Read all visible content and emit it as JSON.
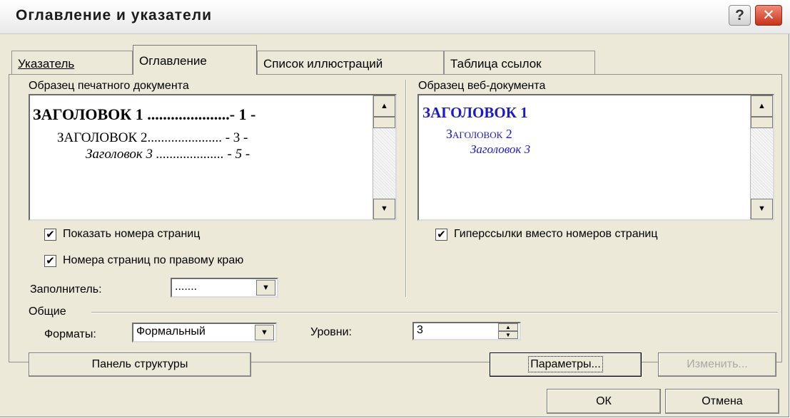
{
  "window": {
    "title": "Оглавление и указатели",
    "help_glyph": "?",
    "close_glyph": "✕"
  },
  "tabs": [
    {
      "label": "Указатель",
      "active": false
    },
    {
      "label": "Оглавление",
      "active": true
    },
    {
      "label": "Список иллюстраций",
      "active": false
    },
    {
      "label": "Таблица ссылок",
      "active": false
    }
  ],
  "print_preview": {
    "label": "Образец печатного документа",
    "lines": [
      {
        "text": "ЗАГОЛОВОК 1",
        "leader": ".....................",
        "page": "- 1 -"
      },
      {
        "text": "ЗАГОЛОВОК 2",
        "leader": "......................",
        "page": "- 3 -"
      },
      {
        "text": "Заголовок 3",
        "leader": "....................",
        "page": "- 5 -"
      }
    ]
  },
  "web_preview": {
    "label": "Образец веб-документа",
    "lines": [
      "ЗАГОЛОВОК 1",
      "Заголовок 2",
      "Заголовок 3"
    ]
  },
  "options": {
    "show_page_numbers": {
      "label": "Показать номера страниц",
      "checked": true
    },
    "right_align": {
      "label": "Номера страниц по правому краю",
      "checked": true
    },
    "hyperlinks": {
      "label": "Гиперссылки вместо номеров страниц",
      "checked": true
    },
    "check_glyph": "✔"
  },
  "tab_leader": {
    "label": "Заполнитель:",
    "value": "......."
  },
  "general": {
    "label": "Общие",
    "formats_label": "Форматы:",
    "formats_value": "Формальный",
    "levels_label": "Уровни:",
    "levels_value": "3"
  },
  "buttons": {
    "outline_toolbar": "Панель структуры",
    "options": "Параметры...",
    "modify": "Изменить...",
    "ok": "ОК",
    "cancel": "Отмена"
  },
  "icons": {
    "arrow_up": "▲",
    "arrow_down": "▼"
  }
}
